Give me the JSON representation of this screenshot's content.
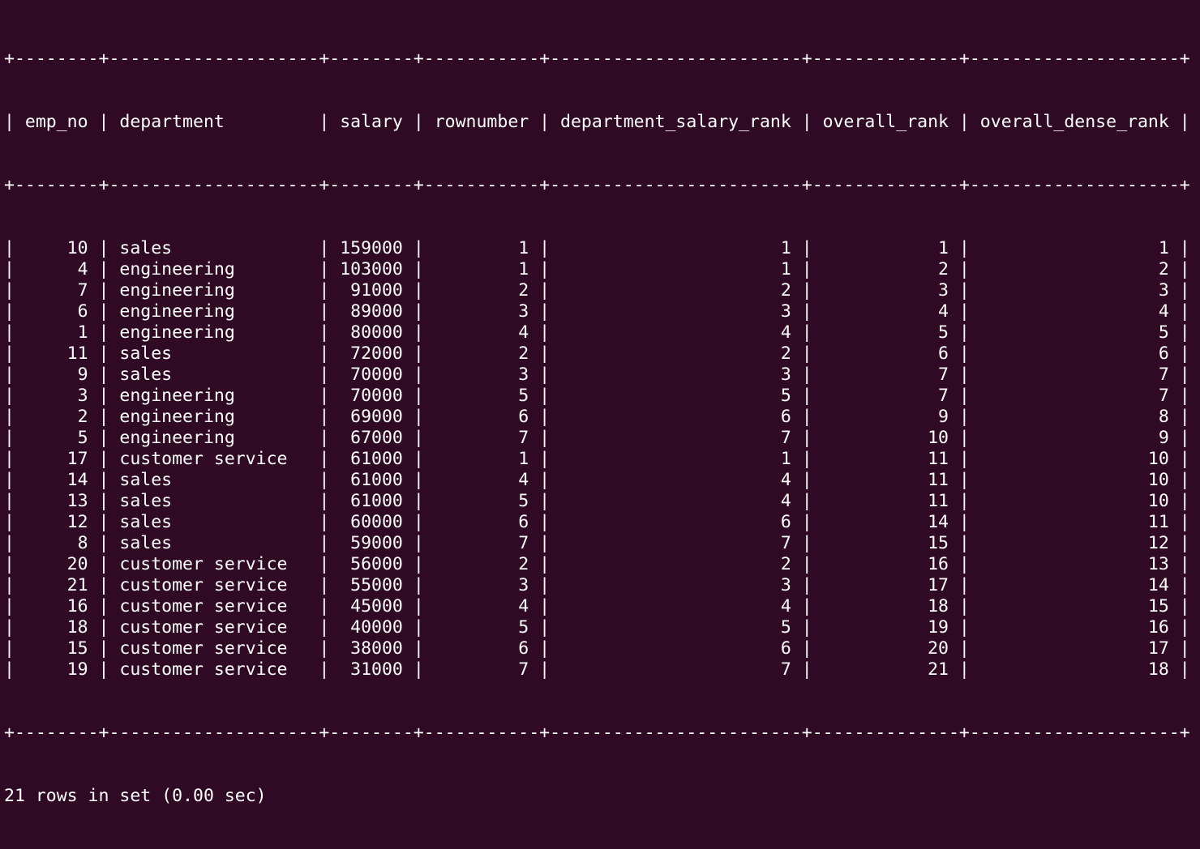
{
  "terminal": {
    "border_line": "+--------+--------------------+--------+-----------+------------------------+--------------+--------------------+",
    "columns": [
      "emp_no",
      "department",
      "salary",
      "rownumber",
      "department_salary_rank",
      "overall_rank",
      "overall_dense_rank"
    ],
    "rows": [
      [
        "10",
        "sales",
        "159000",
        "1",
        "1",
        "1",
        "1"
      ],
      [
        "4",
        "engineering",
        "103000",
        "1",
        "1",
        "2",
        "2"
      ],
      [
        "7",
        "engineering",
        "91000",
        "2",
        "2",
        "3",
        "3"
      ],
      [
        "6",
        "engineering",
        "89000",
        "3",
        "3",
        "4",
        "4"
      ],
      [
        "1",
        "engineering",
        "80000",
        "4",
        "4",
        "5",
        "5"
      ],
      [
        "11",
        "sales",
        "72000",
        "2",
        "2",
        "6",
        "6"
      ],
      [
        "9",
        "sales",
        "70000",
        "3",
        "3",
        "7",
        "7"
      ],
      [
        "3",
        "engineering",
        "70000",
        "5",
        "5",
        "7",
        "7"
      ],
      [
        "2",
        "engineering",
        "69000",
        "6",
        "6",
        "9",
        "8"
      ],
      [
        "5",
        "engineering",
        "67000",
        "7",
        "7",
        "10",
        "9"
      ],
      [
        "17",
        "customer service",
        "61000",
        "1",
        "1",
        "11",
        "10"
      ],
      [
        "14",
        "sales",
        "61000",
        "4",
        "4",
        "11",
        "10"
      ],
      [
        "13",
        "sales",
        "61000",
        "5",
        "4",
        "11",
        "10"
      ],
      [
        "12",
        "sales",
        "60000",
        "6",
        "6",
        "14",
        "11"
      ],
      [
        "8",
        "sales",
        "59000",
        "7",
        "7",
        "15",
        "12"
      ],
      [
        "20",
        "customer service",
        "56000",
        "2",
        "2",
        "16",
        "13"
      ],
      [
        "21",
        "customer service",
        "55000",
        "3",
        "3",
        "17",
        "14"
      ],
      [
        "16",
        "customer service",
        "45000",
        "4",
        "4",
        "18",
        "15"
      ],
      [
        "18",
        "customer service",
        "40000",
        "5",
        "5",
        "19",
        "16"
      ],
      [
        "15",
        "customer service",
        "38000",
        "6",
        "6",
        "20",
        "17"
      ],
      [
        "19",
        "customer service",
        "31000",
        "7",
        "7",
        "21",
        "18"
      ]
    ],
    "status": "21 rows in set (0.00 sec)"
  }
}
